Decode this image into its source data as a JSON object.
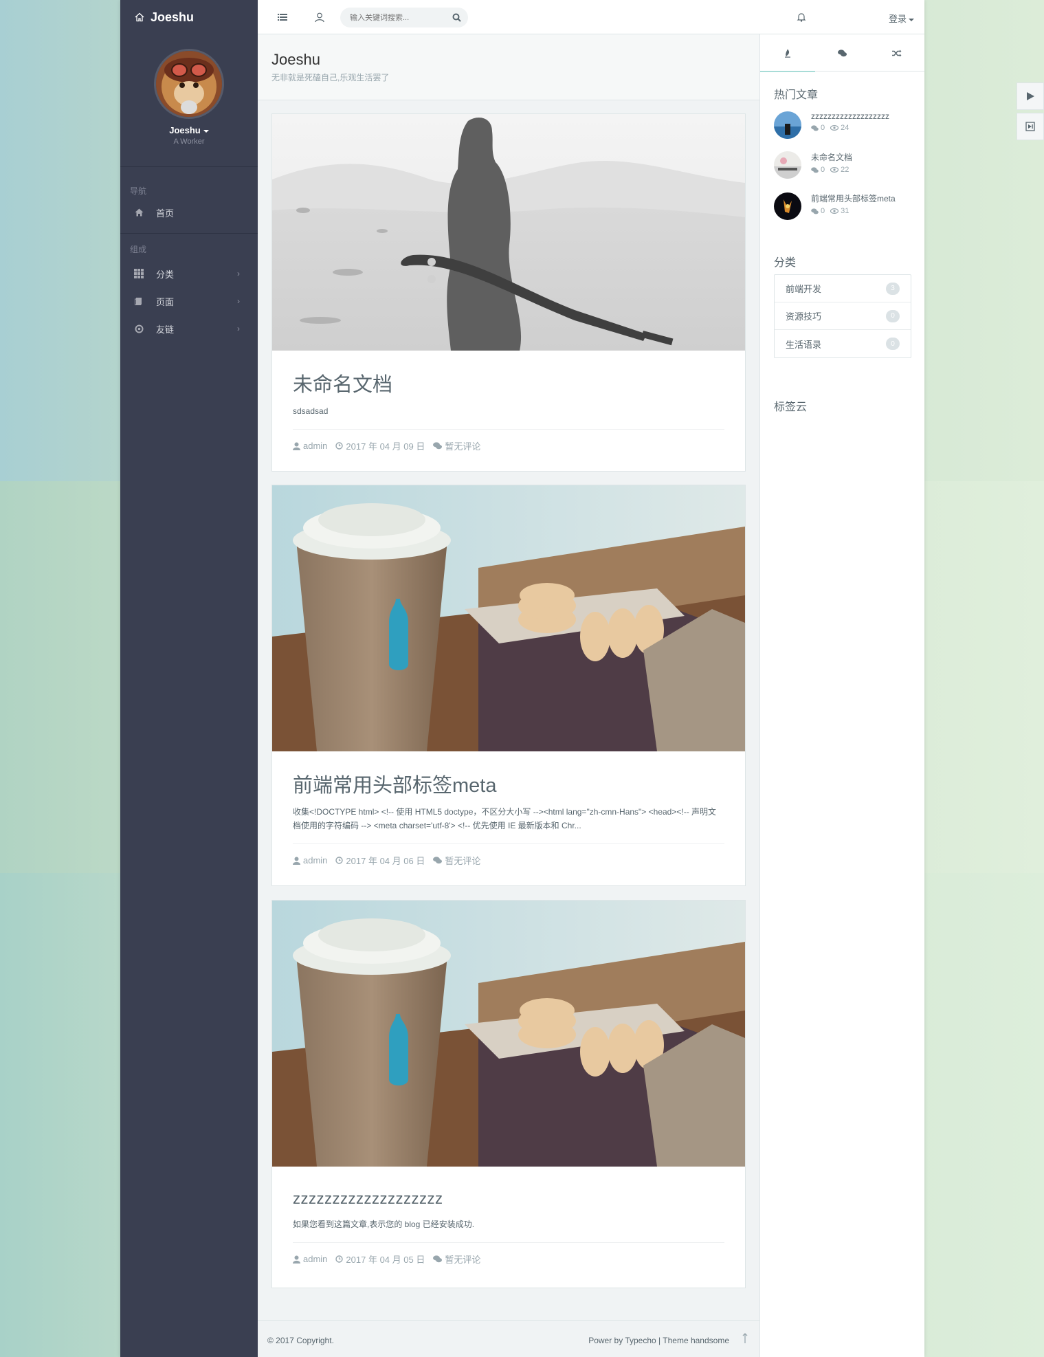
{
  "brand": {
    "title": "Joeshu"
  },
  "profile": {
    "name": "Joeshu",
    "role": "A Worker"
  },
  "nav": {
    "header1": "导航",
    "home": "首页",
    "header2": "组成",
    "items": [
      {
        "label": "分类",
        "icon": "grid-icon"
      },
      {
        "label": "页面",
        "icon": "file-icon"
      },
      {
        "label": "友链",
        "icon": "link-icon"
      }
    ]
  },
  "search": {
    "placeholder": "输入关键词搜索..."
  },
  "header": {
    "login": "登录"
  },
  "page": {
    "title": "Joeshu",
    "subtitle": "无非就是死磕自己,乐观生活罢了"
  },
  "posts": [
    {
      "title": "未命名文档",
      "excerpt": "sdsadsad",
      "author": "admin",
      "date": "2017 年 04 月 09 日",
      "comments": "暂无评论"
    },
    {
      "title": "前端常用头部标签meta",
      "excerpt": "收集<!DOCTYPE html> <!-- 使用 HTML5 doctype，不区分大小写 --><html lang=\"zh-cmn-Hans\"> <head><!-- 声明文档使用的字符编码 --> <meta charset='utf-8'> <!-- 优先使用 IE 最新版本和 Chr...",
      "author": "admin",
      "date": "2017 年 04 月 06 日",
      "comments": "暂无评论"
    },
    {
      "title": "zzzzzzzzzzzzzzzzzzz",
      "excerpt": "如果您看到这篇文章,表示您的 blog 已经安装成功.",
      "author": "admin",
      "date": "2017 年 04 月 05 日",
      "comments": "暂无评论"
    }
  ],
  "sidebar": {
    "hot_title": "热门文章",
    "hot": [
      {
        "title": "zzzzzzzzzzzzzzzzzzz",
        "comments": "0",
        "views": "24"
      },
      {
        "title": "未命名文档",
        "comments": "0",
        "views": "22"
      },
      {
        "title": "前端常用头部标签meta",
        "comments": "0",
        "views": "31"
      }
    ],
    "cat_title": "分类",
    "categories": [
      {
        "label": "前端开发",
        "count": "3"
      },
      {
        "label": "资源技巧",
        "count": "0"
      },
      {
        "label": "生活语录",
        "count": "0"
      }
    ],
    "tag_title": "标签云"
  },
  "footer": {
    "copyright": "© 2017 Copyright.",
    "power": "Power by Typecho | Theme handsome"
  },
  "colors": {
    "aside": "#3a3f51",
    "accent": "#a8dcd7",
    "text": "#58666e",
    "muted": "#98a6ad"
  }
}
